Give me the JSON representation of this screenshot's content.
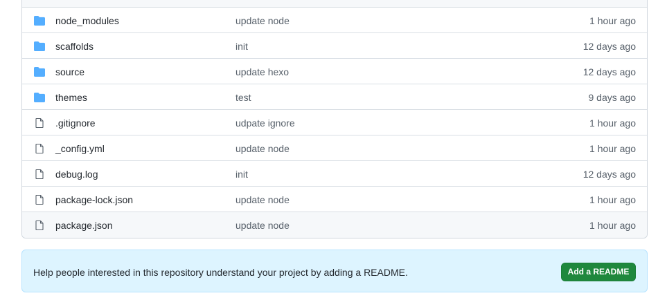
{
  "files": [
    {
      "name": "node_modules",
      "type": "folder",
      "icon": "folder-icon",
      "message": "update node",
      "age": "1 hour ago"
    },
    {
      "name": "scaffolds",
      "type": "folder",
      "icon": "folder-icon",
      "message": "init",
      "age": "12 days ago"
    },
    {
      "name": "source",
      "type": "folder",
      "icon": "folder-icon",
      "message": "update hexo",
      "age": "12 days ago"
    },
    {
      "name": "themes",
      "type": "folder",
      "icon": "folder-icon",
      "message": "test",
      "age": "9 days ago"
    },
    {
      "name": ".gitignore",
      "type": "file",
      "icon": "file-icon",
      "message": "udpate ignore",
      "age": "1 hour ago"
    },
    {
      "name": "_config.yml",
      "type": "file",
      "icon": "file-icon",
      "message": "update node",
      "age": "1 hour ago"
    },
    {
      "name": "debug.log",
      "type": "file",
      "icon": "file-icon",
      "message": "init",
      "age": "12 days ago"
    },
    {
      "name": "package-lock.json",
      "type": "file",
      "icon": "file-icon",
      "message": "update node",
      "age": "1 hour ago"
    },
    {
      "name": "package.json",
      "type": "file",
      "icon": "file-icon",
      "message": "update node",
      "age": "1 hour ago"
    }
  ],
  "readme": {
    "text": "Help people interested in this repository understand your project by adding a README.",
    "button_label": "Add a README"
  },
  "colors": {
    "folder": "#54aeff",
    "file": "#57606a",
    "button": "#1f883d",
    "banner": "#ddf4ff"
  }
}
